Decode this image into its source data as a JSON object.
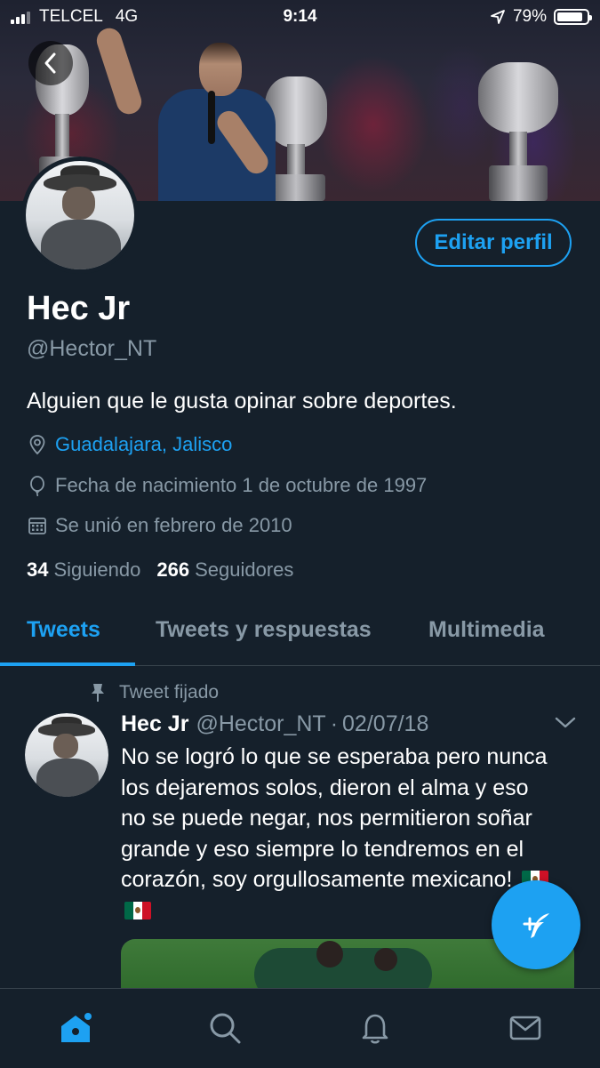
{
  "status_bar": {
    "carrier": "TELCEL",
    "network": "4G",
    "time": "9:14",
    "battery": "79%",
    "battery_level": 0.79
  },
  "profile": {
    "edit_label": "Editar perfil",
    "name": "Hec Jr",
    "handle": "@Hector_NT",
    "bio": "Alguien que le gusta opinar sobre deportes.",
    "location": "Guadalajara, Jalisco",
    "birthday": "Fecha de nacimiento 1 de octubre de 1997",
    "joined": "Se unió en febrero de 2010",
    "following_count": "34",
    "following_label": "Siguiendo",
    "followers_count": "266",
    "followers_label": "Seguidores"
  },
  "tabs": [
    {
      "label": "Tweets",
      "active": true
    },
    {
      "label": "Tweets y respuestas",
      "active": false
    },
    {
      "label": "Multimedia",
      "active": false
    }
  ],
  "tweet": {
    "pinned_label": "Tweet fijado",
    "author": "Hec Jr",
    "handle": "@Hector_NT",
    "separator": "·",
    "date": "02/07/18",
    "text": "No se logró lo que se esperaba pero nunca los dejaremos solos, dieron el alma y eso no se puede negar, nos permitieron soñar grande y eso siempre lo tendremos en el corazón, soy orgullosamente mexicano!"
  },
  "colors": {
    "background": "#15202b",
    "accent": "#1da1f2",
    "secondary_text": "#8899a6",
    "divider": "#38444d"
  },
  "icons": {
    "back": "back-arrow-icon",
    "location": "location-pin-icon",
    "birthday": "balloon-icon",
    "joined": "calendar-icon",
    "pin": "pin-icon",
    "caret": "chevron-down-icon",
    "compose": "compose-feather-icon",
    "nav": [
      "home-icon",
      "search-icon",
      "bell-icon",
      "mail-icon"
    ]
  }
}
